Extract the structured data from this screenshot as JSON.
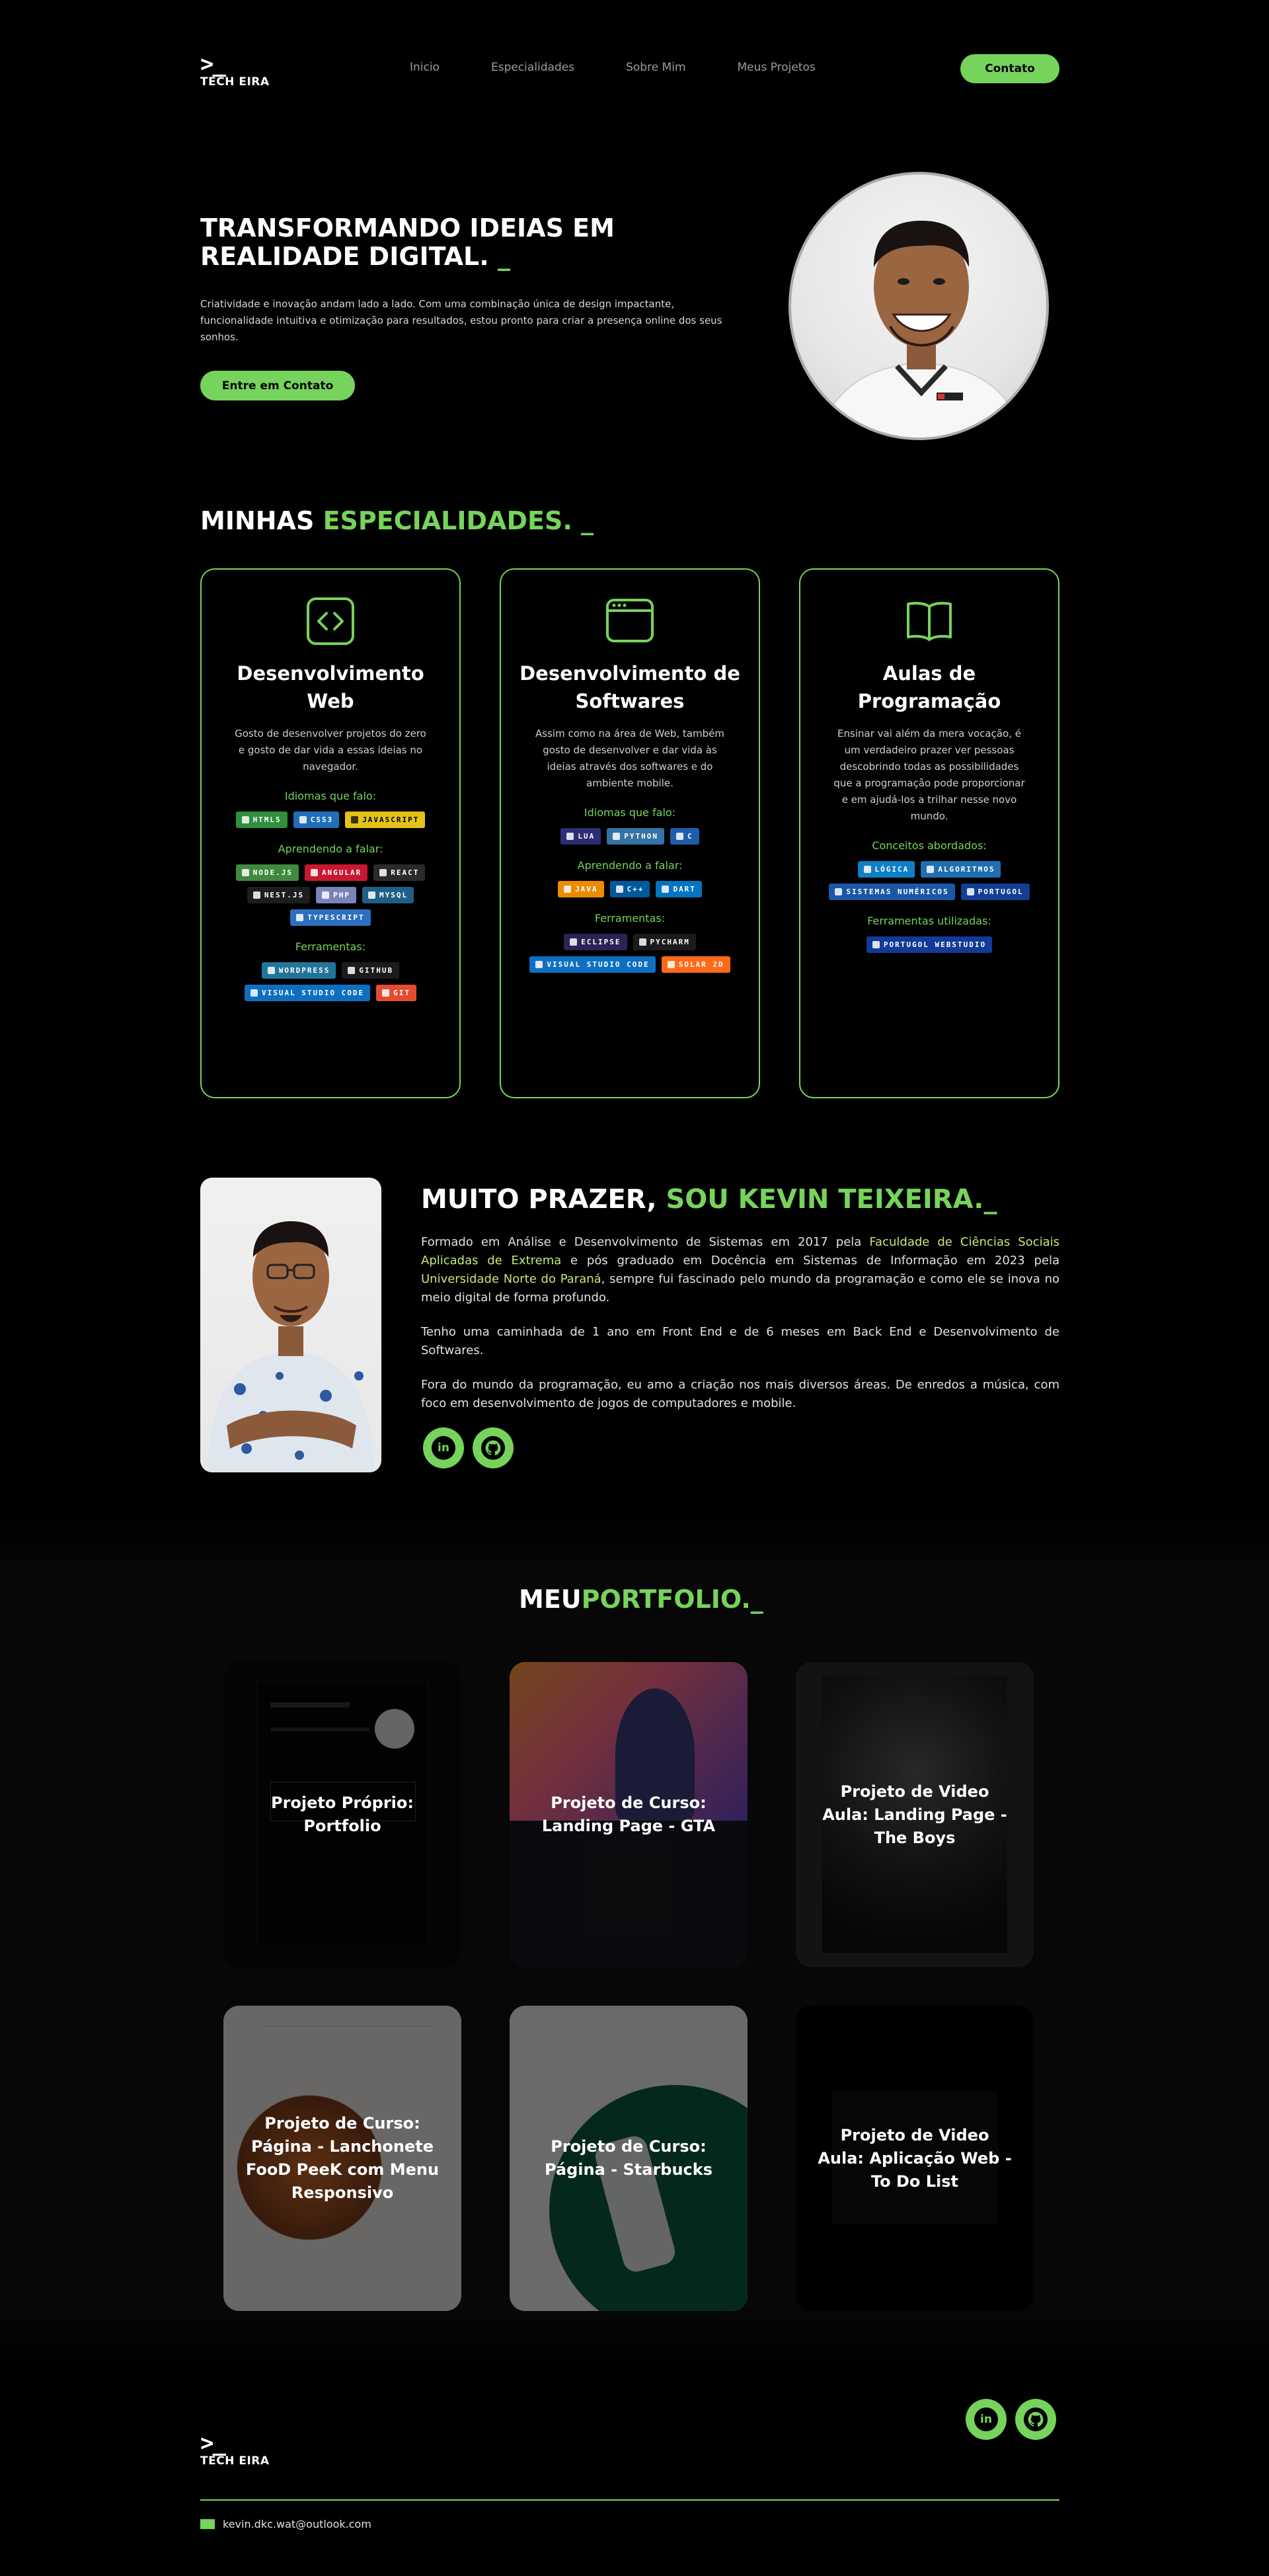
{
  "nav": {
    "logo_mark": ">_",
    "logo_text": "TECH EIRA",
    "links": [
      "Inicio",
      "Especialidades",
      "Sobre Mim",
      "Meus Projetos"
    ],
    "contact_label": "Contato"
  },
  "hero": {
    "title_main": "TRANSFORMANDO IDEIAS EM REALIDADE DIGITAL.",
    "title_cursor": "_",
    "text": "Criatividade e inovação andam lado a lado. Com uma combinação única de design impactante, funcionalidade intuitiva e otimização para resultados, estou pronto para criar a presença online dos seus sonhos.",
    "button": "Entre em Contato"
  },
  "specialties": {
    "title_a": "MINHAS ",
    "title_b": "ESPECIALIDADES. _",
    "cards": [
      {
        "title": "Desenvolvimento Web",
        "icon": "code-window-icon",
        "desc": "Gosto de desenvolver projetos do zero e gosto de dar vida a essas ideias no navegador.",
        "groups": [
          {
            "label": "Idiomas que falo:",
            "badges": [
              {
                "text": "HTML5",
                "color": "#2f8f3f"
              },
              {
                "text": "CSS3",
                "color": "#1e6fb8"
              },
              {
                "text": "JAVASCRIPT",
                "color": "#e3c31a",
                "dark": true
              }
            ]
          },
          {
            "label": "Aprendendo a falar:",
            "badges": [
              {
                "text": "NODE.JS",
                "color": "#3f8a3e"
              },
              {
                "text": "ANGULAR",
                "color": "#c8172e"
              },
              {
                "text": "REACT",
                "color": "#2a2a2a"
              },
              {
                "text": "NEST.JS",
                "color": "#1d1d1d"
              },
              {
                "text": "PHP",
                "color": "#7a84bb"
              },
              {
                "text": "MYSQL",
                "color": "#1f5f86"
              },
              {
                "text": "TYPESCRIPT",
                "color": "#2b6fbf"
              }
            ]
          },
          {
            "label": "Ferramentas:",
            "badges": [
              {
                "text": "WORDPRESS",
                "color": "#21759b"
              },
              {
                "text": "GITHUB",
                "color": "#1b1b1b"
              },
              {
                "text": "VISUAL STUDIO CODE",
                "color": "#0e6fc0"
              },
              {
                "text": "GIT",
                "color": "#e44c30"
              }
            ]
          }
        ]
      },
      {
        "title": "Desenvolvimento de Softwares",
        "icon": "app-window-icon",
        "desc": "Assim como na área de Web, também gosto de desenvolver e dar vida às ideias através dos softwares e do ambiente mobile.",
        "groups": [
          {
            "label": "Idiomas que falo:",
            "badges": [
              {
                "text": "LUA",
                "color": "#2c2d72"
              },
              {
                "text": "PYTHON",
                "color": "#3572a5"
              },
              {
                "text": "C",
                "color": "#1e5ea8"
              }
            ]
          },
          {
            "label": "Aprendendo a falar:",
            "badges": [
              {
                "text": "JAVA",
                "color": "#ed8b00"
              },
              {
                "text": "C++",
                "color": "#00599c"
              },
              {
                "text": "DART",
                "color": "#0175c2"
              }
            ]
          },
          {
            "label": "Ferramentas:",
            "badges": [
              {
                "text": "ECLIPSE",
                "color": "#2c2255"
              },
              {
                "text": "PYCHARM",
                "color": "#1b1b1b"
              },
              {
                "text": "VISUAL STUDIO CODE",
                "color": "#0e6fc0"
              },
              {
                "text": "SOLAR 2D",
                "color": "#ff6a1a"
              }
            ]
          }
        ]
      },
      {
        "title": "Aulas de Programação",
        "icon": "open-book-icon",
        "desc": "Ensinar vai além da mera vocação, é um verdadeiro prazer ver pessoas descobrindo todas as possibilidades que a programação pode proporcionar e em ajudá-los a trilhar nesse novo mundo.",
        "groups": [
          {
            "label": "Conceitos abordados:",
            "badges": [
              {
                "text": "LÓGICA",
                "color": "#0e7fc8"
              },
              {
                "text": "ALGORITMOS",
                "color": "#1f6fb2"
              },
              {
                "text": "SISTEMAS NUMÉRICOS",
                "color": "#1a57a6"
              },
              {
                "text": "PORTUGOL",
                "color": "#123f94"
              }
            ]
          },
          {
            "label": "Ferramentas utilizadas:",
            "badges": [
              {
                "text": "PORTUGOL WEBSTUDIO",
                "color": "#123a96"
              }
            ]
          }
        ]
      }
    ]
  },
  "about": {
    "title_a": "MUITO PRAZER, ",
    "title_b": "SOU KEVIN TEIXEIRA.",
    "title_c": "_",
    "p1_a": "Formado em Análise e Desenvolvimento de Sistemas em 2017 pela ",
    "p1_b": "Faculdade de Ciências Sociais Aplicadas de Extrema",
    "p1_c": " e pós graduado em Docência em Sistemas de Informação em 2023 pela ",
    "p1_d": "Universidade Norte do Paraná",
    "p1_e": ", sempre fui fascinado pelo mundo da programação e como ele se inova no meio digital de forma profundo.",
    "p2": "Tenho uma caminhada de 1 ano em Front End e de 6 meses em Back End e Desenvolvimento de Softwares.",
    "p3": "Fora do mundo da programação, eu amo a criação nos mais diversos áreas. De enredos a música, com foco em desenvolvimento de jogos de computadores e mobile.",
    "linkedin": "in",
    "github": "gh"
  },
  "portfolio": {
    "title_a": "MEU",
    "title_b": "PORTFOLIO._",
    "projects": [
      {
        "label": "Projeto Próprio: Portfolio",
        "bg": "#0a0a0a"
      },
      {
        "label": "Projeto de Curso: Landing Page - GTA",
        "bg": "#1a1a22"
      },
      {
        "label": "Projeto de Video Aula: Landing Page - The Boys",
        "bg": "#2a2a2a"
      },
      {
        "label": "Projeto de Curso: Página - Lanchonete FooD PeeK com Menu Responsivo",
        "bg": "#e8e4df"
      },
      {
        "label": "Projeto de Curso: Página - Starbucks",
        "bg": "#ececec"
      },
      {
        "label": "Projeto de Video Aula: Aplicação Web - To Do List",
        "bg": "#000000"
      }
    ]
  },
  "footer": {
    "logo_mark": ">_",
    "logo_text": "TECH EIRA",
    "email": "kevin.dkc.wat@outlook.com"
  }
}
